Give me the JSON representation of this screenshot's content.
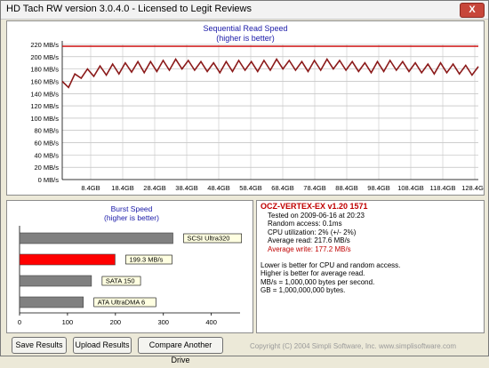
{
  "window": {
    "title": "HD Tach RW version 3.0.4.0 - Licensed to Legit Reviews",
    "close_label": "X"
  },
  "read_chart": {
    "title": "Sequential Read Speed",
    "subtitle": "(higher is better)",
    "y_ticks": [
      "220 MB/s",
      "200 MB/s",
      "180 MB/s",
      "160 MB/s",
      "140 MB/s",
      "120 MB/s",
      "100 MB/s",
      "80 MB/s",
      "60 MB/s",
      "40 MB/s",
      "20 MB/s",
      "0 MB/s"
    ],
    "x_ticks": [
      "8.4GB",
      "18.4GB",
      "28.4GB",
      "38.4GB",
      "48.4GB",
      "58.4GB",
      "68.4GB",
      "78.4GB",
      "88.4GB",
      "98.4GB",
      "108.4GB",
      "118.4GB",
      "128.4GB"
    ]
  },
  "burst_chart": {
    "title": "Burst Speed",
    "subtitle": "(higher is better)",
    "x_ticks": [
      "0",
      "100",
      "200",
      "300",
      "400"
    ]
  },
  "chart_data": [
    {
      "type": "line",
      "title": "Sequential Read Speed",
      "subtitle": "(higher is better)",
      "ylim": [
        0,
        225
      ],
      "xlim": [
        0,
        132
      ],
      "x": [
        0,
        2,
        4,
        6,
        8,
        10,
        12,
        14,
        16,
        18,
        20,
        22,
        24,
        26,
        28,
        30,
        32,
        34,
        36,
        38,
        40,
        42,
        44,
        46,
        48,
        50,
        52,
        54,
        56,
        58,
        60,
        62,
        64,
        66,
        68,
        70,
        72,
        74,
        76,
        78,
        80,
        82,
        84,
        86,
        88,
        90,
        92,
        94,
        96,
        98,
        100,
        102,
        104,
        106,
        108,
        110,
        112,
        114,
        116,
        118,
        120,
        122,
        124,
        126,
        128,
        130,
        132
      ],
      "series": [
        {
          "values": [
            160,
            150,
            172,
            165,
            180,
            168,
            185,
            170,
            188,
            172,
            190,
            175,
            192,
            174,
            192,
            176,
            194,
            178,
            196,
            180,
            194,
            178,
            192,
            176,
            190,
            174,
            192,
            176,
            194,
            178,
            192,
            176,
            194,
            178,
            196,
            180,
            194,
            178,
            192,
            176,
            194,
            178,
            196,
            180,
            194,
            178,
            192,
            176,
            190,
            174,
            192,
            176,
            194,
            178,
            192,
            176,
            190,
            174,
            188,
            172,
            190,
            174,
            188,
            172,
            186,
            170,
            184
          ]
        },
        {
          "values": [
            217,
            217,
            217,
            217,
            217,
            217,
            217,
            217,
            217,
            217,
            217,
            217,
            217,
            217,
            217,
            217,
            217,
            217,
            217,
            217,
            217,
            217,
            217,
            217,
            217,
            217,
            217,
            217,
            217,
            217,
            217,
            217,
            217,
            217,
            217,
            217,
            217,
            217,
            217,
            217,
            217,
            217,
            217,
            217,
            217,
            217,
            217,
            217,
            217,
            217,
            217,
            217,
            217,
            217,
            217,
            217,
            217,
            217,
            217,
            217,
            217,
            217,
            217,
            217,
            217,
            217,
            217
          ]
        }
      ],
      "grid": true
    },
    {
      "type": "bar",
      "title": "Burst Speed",
      "subtitle": "(higher is better)",
      "categories": [
        "SCSI Ultra320",
        "199.3 MB/s",
        "SATA 150",
        "ATA UltraDMA 6"
      ],
      "values": [
        320,
        199.3,
        150,
        133
      ],
      "xlim": [
        0,
        460
      ],
      "highlight": "#ff0000",
      "bar_color": "#808080"
    }
  ],
  "info": {
    "drive": "OCZ-VERTEX-EX v1.20 1571",
    "tested": "Tested on 2009-06-16 at 20:23",
    "random": "Random access: 0.1ms",
    "cpu": "CPU utilization: 2% (+/- 2%)",
    "avg_read": "Average read: 217.6 MB/s",
    "avg_write": "Average write: 177.2 MB/s",
    "note1": "Lower is better for CPU and random access.",
    "note2": "Higher is better for average read.",
    "note3": "MB/s = 1,000,000 bytes per second.",
    "note4": "GB = 1,000,000,000 bytes."
  },
  "buttons": {
    "save": "Save Results",
    "upload": "Upload Results",
    "compare": "Compare Another Drive"
  },
  "footer": {
    "copyright": "Copyright (C) 2004 Simpli Software, Inc. www.simplisoftware.com"
  },
  "colors": {
    "read_line": "#8b1a1a",
    "accent_line": "#cc0000",
    "burst_highlight": "#ff0000",
    "bar_gray": "#808080"
  }
}
